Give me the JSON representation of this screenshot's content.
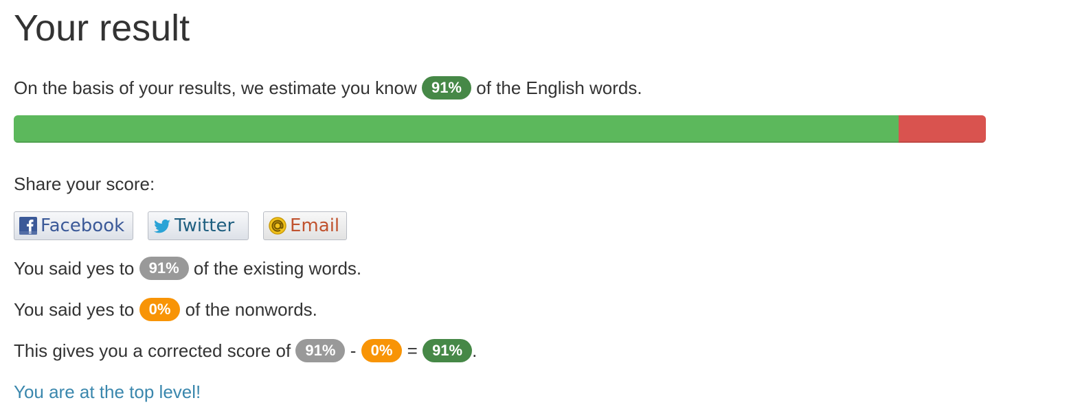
{
  "page": {
    "title": "Your result"
  },
  "estimate": {
    "text_before": "On the basis of your results, we estimate you know",
    "percent": "91%",
    "text_after": "of the English words."
  },
  "progress": {
    "known_fraction": 0.91,
    "known_color": "#5cb85c",
    "unknown_color": "#d9534f"
  },
  "share": {
    "label": "Share your score:",
    "buttons": [
      {
        "label": "Facebook",
        "icon": "facebook-icon",
        "color": "#3b5998"
      },
      {
        "label": "Twitter",
        "icon": "twitter-icon",
        "color": "#1f5f80"
      },
      {
        "label": "Email",
        "icon": "email-icon",
        "color": "#c0522e"
      }
    ]
  },
  "existing": {
    "text_before": "You said yes to",
    "percent": "91%",
    "text_after": "of the existing words."
  },
  "nonwords": {
    "text_before": "You said yes to",
    "percent": "0%",
    "text_after": "of the nonwords."
  },
  "corrected": {
    "text_before": "This gives you a corrected score of",
    "existing_percent": "91%",
    "minus": "-",
    "nonwords_percent": "0%",
    "equals": "=",
    "result_percent": "91%",
    "period": "."
  },
  "level": {
    "text": "You are at the top level!"
  },
  "colors": {
    "badge_green": "#468847",
    "badge_grey": "#999999",
    "badge_orange": "#f89406",
    "link": "#3a87ad"
  }
}
